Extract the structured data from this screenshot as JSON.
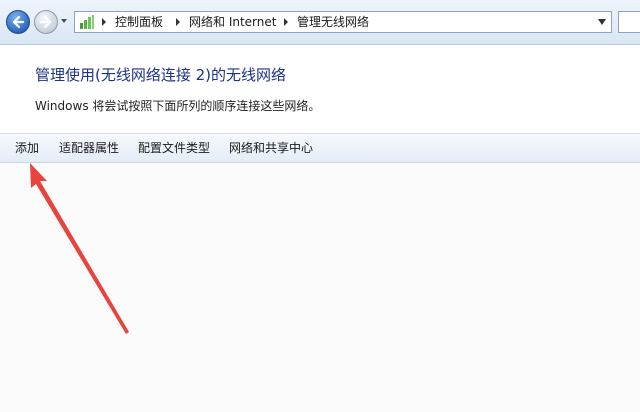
{
  "address_bar": {
    "breadcrumbs": [
      "控制面板",
      "网络和 Internet",
      "管理无线网络"
    ]
  },
  "page": {
    "heading": "管理使用(无线网络连接 2)的无线网络",
    "description": "Windows 将尝试按照下面所列的顺序连接这些网络。"
  },
  "command_bar": {
    "add": "添加",
    "adapter_properties": "适配器属性",
    "profile_types": "配置文件类型",
    "network_sharing_center": "网络和共享中心"
  },
  "annotation": {
    "arrow_color": "#e8433c"
  },
  "icons": {
    "back": "back-arrow-icon",
    "forward": "forward-arrow-icon",
    "address": "control-panel-icon",
    "dropdown": "chevron-down-icon"
  }
}
